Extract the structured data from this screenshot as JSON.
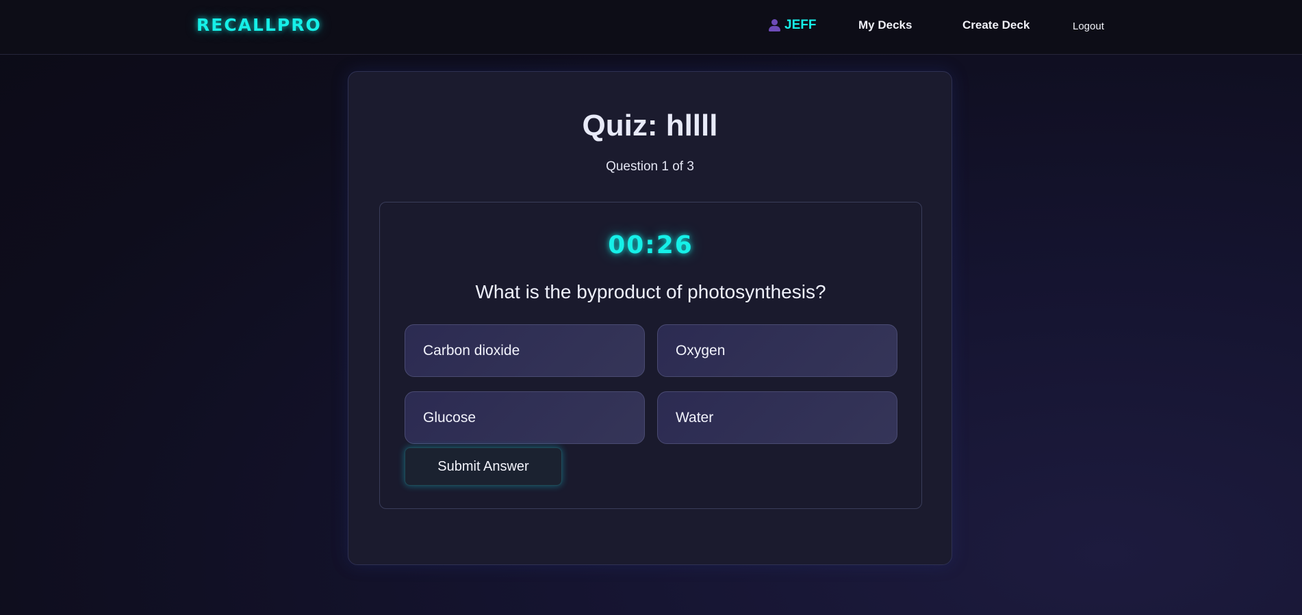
{
  "nav": {
    "brand": "RECALLPRO",
    "user": {
      "icon": "user-icon",
      "name": "JEFF"
    },
    "links": {
      "my_decks": "My Decks",
      "create_deck": "Create Deck",
      "logout": "Logout"
    }
  },
  "quiz": {
    "title": "Quiz: hllll",
    "progress": "Question 1 of 3",
    "timer": "00:26",
    "question": "What is the byproduct of photosynthesis?",
    "options": [
      "Carbon dioxide",
      "Oxygen",
      "Glucose",
      "Water"
    ],
    "submit_label": "Submit Answer"
  },
  "colors": {
    "accent": "#16f0e8",
    "background": "#0e0d1c",
    "card": "#1b1b2e",
    "option": "#2c2b52",
    "user_icon": "#6d4bb8"
  }
}
